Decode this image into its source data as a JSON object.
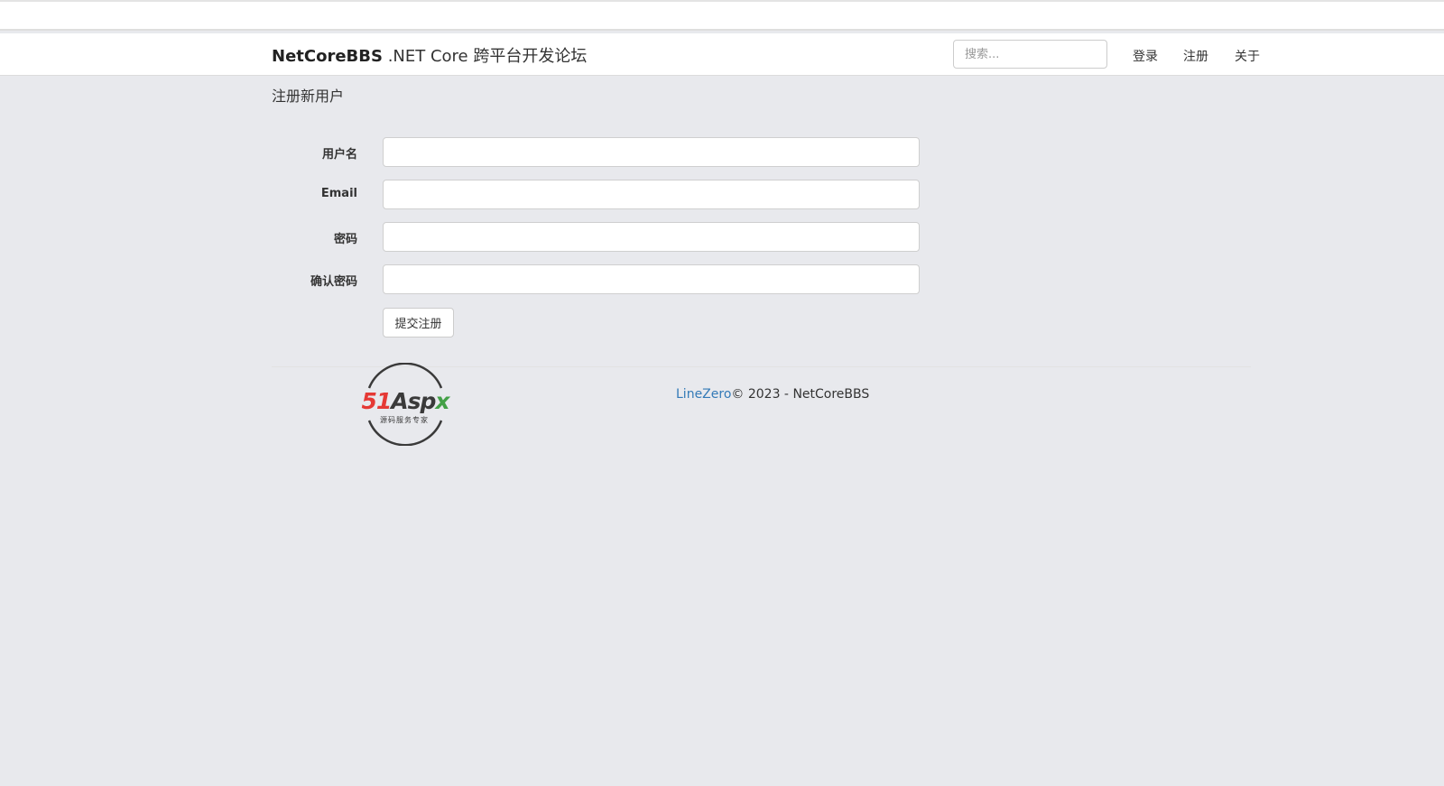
{
  "header": {
    "brand_bold": "NetCoreBBS",
    "brand_sub": ".NET Core 跨平台开发论坛",
    "search_placeholder": "搜索...",
    "nav": [
      "登录",
      "注册",
      "关于"
    ]
  },
  "page": {
    "title": "注册新用户"
  },
  "form": {
    "username_label": "用户名",
    "email_label": "Email",
    "password_label": "密码",
    "confirm_label": "确认密码",
    "submit_label": "提交注册"
  },
  "footer": {
    "author_link": "LineZero",
    "copyright": "© 2023 - NetCoreBBS",
    "logo_text": "51Aspx",
    "logo_subtitle": "源码服务专家"
  },
  "colors": {
    "background": "#e8e9ed",
    "link": "#337ab7",
    "logo_red": "#e53935",
    "logo_dark": "#3a3a3a",
    "logo_green": "#43a047"
  }
}
